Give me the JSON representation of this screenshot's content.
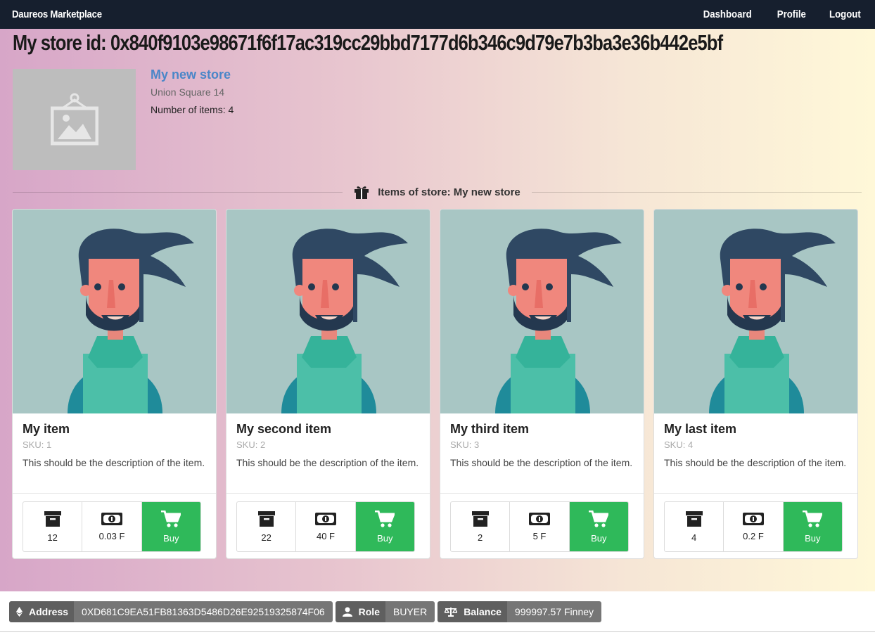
{
  "app": {
    "brand": "Daureos Marketplace"
  },
  "nav": {
    "dashboard": "Dashboard",
    "profile": "Profile",
    "logout": "Logout"
  },
  "store": {
    "id_label": "My store id: 0x840f9103e98671f6f17ac319cc29bbd7177d6b346c9d79e7b3ba3e36b442e5bf",
    "name": "My new store",
    "address": "Union Square 14",
    "count_text": "Number of items: 4"
  },
  "section": {
    "title": "Items of store: My new store"
  },
  "items": [
    {
      "title": "My item",
      "sku": "SKU: 1",
      "desc": "This should be the description of the item.",
      "qty": "12",
      "price": "0.03 F",
      "buy": "Buy"
    },
    {
      "title": "My second item",
      "sku": "SKU: 2",
      "desc": "This should be the description of the item.",
      "qty": "22",
      "price": "40 F",
      "buy": "Buy"
    },
    {
      "title": "My third item",
      "sku": "SKU: 3",
      "desc": "This should be the description of the item.",
      "qty": "2",
      "price": "5 F",
      "buy": "Buy"
    },
    {
      "title": "My last item",
      "sku": "SKU: 4",
      "desc": "This should be the description of the item.",
      "qty": "4",
      "price": "0.2 F",
      "buy": "Buy"
    }
  ],
  "footer": {
    "address_label": "Address",
    "address_value": "0XD681C9EA51FB81363D5486D26E92519325874F06",
    "role_label": "Role",
    "role_value": "BUYER",
    "balance_label": "Balance",
    "balance_value": "999997.57 Finney"
  },
  "colors": {
    "navbar": "#161f2e",
    "buy": "#2fb95a",
    "link": "#4a86c8"
  },
  "icons": [
    "image-placeholder-icon",
    "gift-icon",
    "archive-icon",
    "money-icon",
    "cart-icon",
    "ethereum-icon",
    "user-icon",
    "balance-scale-icon"
  ]
}
